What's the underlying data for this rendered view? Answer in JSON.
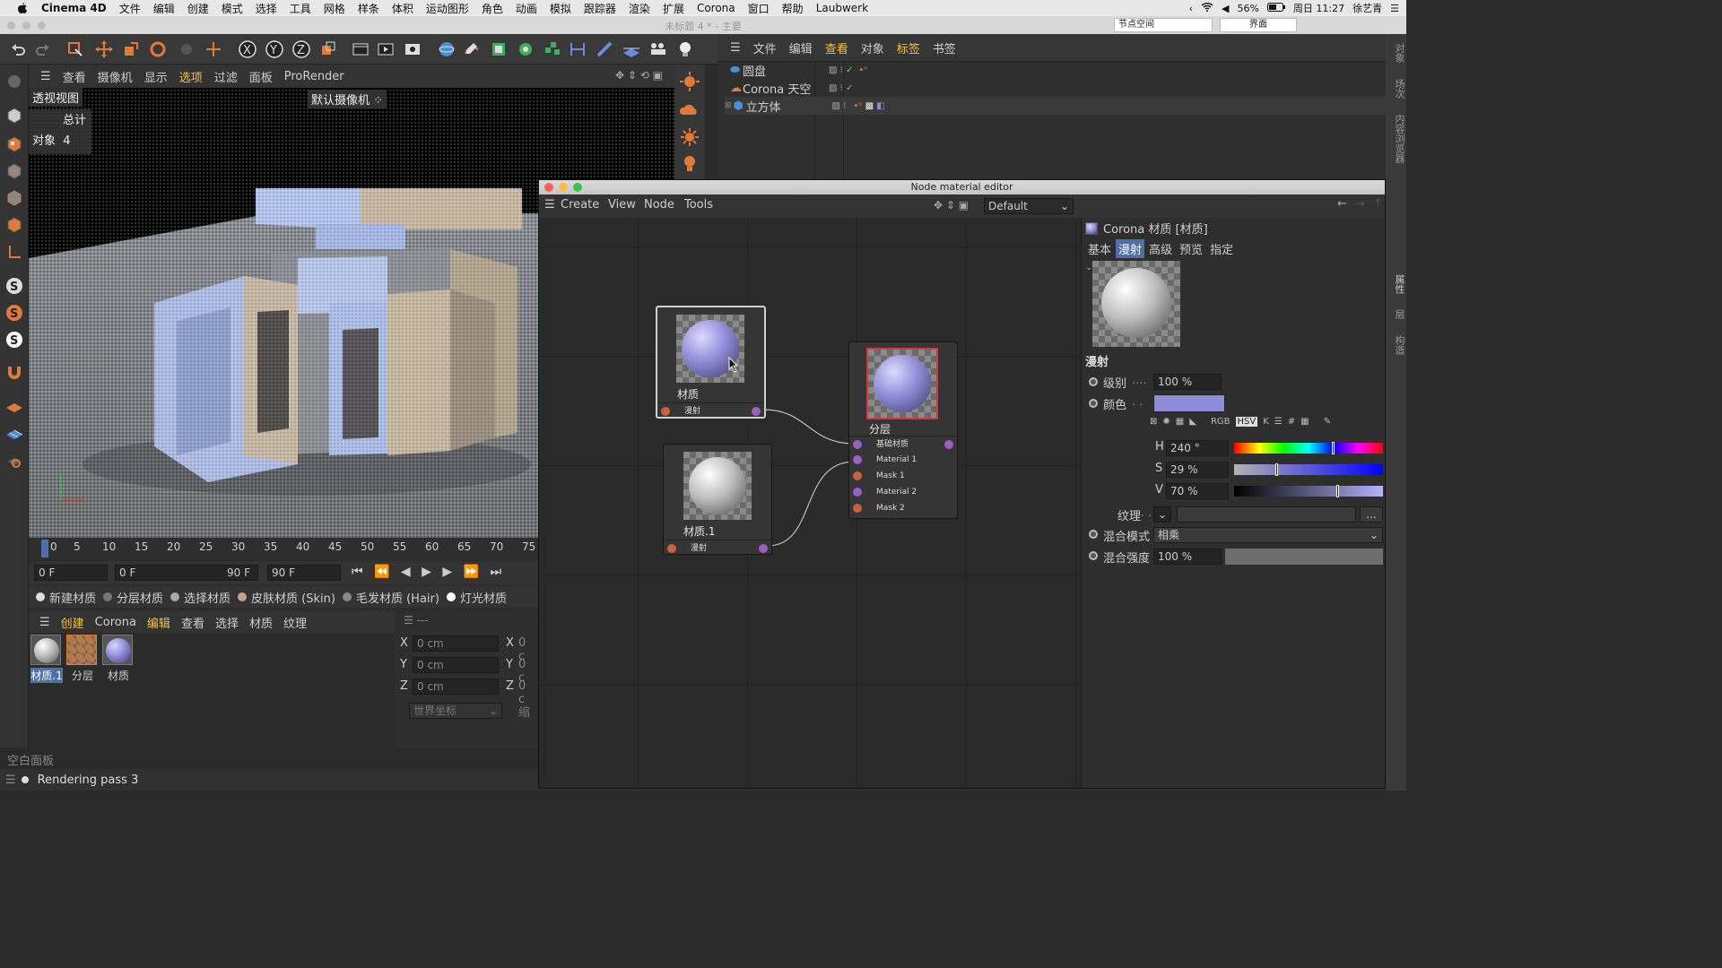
{
  "menubar": {
    "app": "Cinema 4D",
    "items": [
      "文件",
      "编辑",
      "创建",
      "模式",
      "选择",
      "工具",
      "网格",
      "样条",
      "体积",
      "运动图形",
      "角色",
      "动画",
      "模拟",
      "跟踪器",
      "渲染",
      "扩展",
      "Corona",
      "窗口",
      "帮助",
      "Laubwerk"
    ],
    "battery": "56%",
    "clock": "周日 11:27",
    "user": "徐艺青"
  },
  "window": {
    "title": "未标题 4 * - 主要",
    "node_space": "节点空间",
    "layout": "界面"
  },
  "viewport": {
    "menu": [
      "查看",
      "摄像机",
      "显示",
      "选项",
      "过滤",
      "面板",
      "ProRender"
    ],
    "view_name": "透视视图",
    "camera": "默认摄像机",
    "stats_header": "总计",
    "stats_label": "对象",
    "stats_value": "4"
  },
  "object_manager": {
    "menu": [
      "文件",
      "编辑",
      "查看",
      "对象",
      "标签",
      "书签"
    ],
    "objects": [
      {
        "name": "圆盘"
      },
      {
        "name": "Corona 天空"
      },
      {
        "name": "立方体"
      }
    ]
  },
  "timeline": {
    "ticks": [
      "0",
      "5",
      "10",
      "15",
      "20",
      "25",
      "30",
      "35",
      "40",
      "45",
      "50",
      "55",
      "60",
      "65",
      "70",
      "75"
    ],
    "start": "0 F",
    "min": "0 F",
    "max": "90 F",
    "end": "90 F"
  },
  "material_toolbar": [
    "新建材质",
    "分层材质",
    "选择材质",
    "皮肤材质 (Skin)",
    "毛发材质 (Hair)",
    "灯光材质"
  ],
  "material_manager": {
    "menu": [
      "创建",
      "Corona",
      "编辑",
      "查看",
      "选择",
      "材质",
      "纹理"
    ],
    "materials": [
      {
        "label": "材质.1"
      },
      {
        "label": "分层"
      },
      {
        "label": "材质"
      }
    ]
  },
  "coordinates": {
    "rows": [
      {
        "axis": "X",
        "value": "0 cm",
        "axis2": "X",
        "value2": "0 c"
      },
      {
        "axis": "Y",
        "value": "0 cm",
        "axis2": "Y",
        "value2": "0 c"
      },
      {
        "axis": "Z",
        "value": "0 cm",
        "axis2": "Z",
        "value2": "0 c"
      }
    ],
    "mode": "世界坐标",
    "scale": "缩"
  },
  "status": {
    "panel": "空白面板",
    "message": "Rendering pass 3"
  },
  "node_editor": {
    "title": "Node material editor",
    "menu": [
      "Create",
      "View",
      "Node",
      "Tools"
    ],
    "preset": "Default",
    "nodes": {
      "material": {
        "label": "材质",
        "port": "漫射"
      },
      "material1": {
        "label": "材质.1",
        "port": "漫射"
      },
      "layered": {
        "label": "分层",
        "ports": [
          "基础材质",
          "Material 1",
          "Mask 1",
          "Material 2",
          "Mask 2"
        ]
      }
    },
    "attributes": {
      "header": "Corona 材质 [材质]",
      "tabs": [
        "基本",
        "漫射",
        "高级",
        "预览",
        "指定"
      ],
      "active_tab": "漫射",
      "section": "漫射",
      "level_label": "级别",
      "level_value": "100 %",
      "color_label": "颜色",
      "color_hex": "#8f8cd6",
      "color_modes": [
        "RGB",
        "HSV",
        "K"
      ],
      "h_label": "H",
      "h_value": "240 °",
      "s_label": "S",
      "s_value": "29 %",
      "v_label": "V",
      "v_value": "70 %",
      "hsv": {
        "h": 240,
        "s": 29,
        "v": 70
      },
      "texture_label": "纹理",
      "texture_more": "...",
      "blend_mode_label": "混合模式",
      "blend_mode_value": "相乘",
      "blend_strength_label": "混合强度",
      "blend_strength_value": "100 %"
    }
  },
  "side_tabs": [
    "对象",
    "场次",
    "内容浏览器",
    "属性",
    "层",
    "构造"
  ],
  "colors": {
    "accent_tab": "#4e6fa8",
    "port_purple": "#9b5fc4",
    "port_orange": "#c8643c",
    "selected_node_border": "#d03a3a"
  }
}
